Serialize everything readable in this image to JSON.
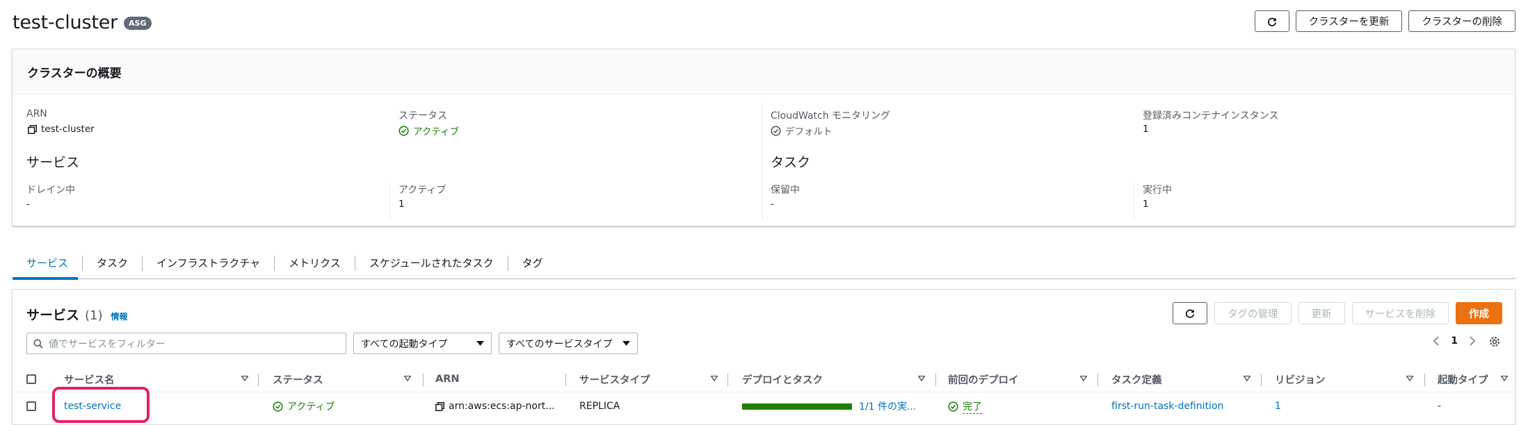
{
  "header": {
    "title": "test-cluster",
    "badge": "ASG",
    "update_button": "クラスターを更新",
    "delete_button": "クラスターの削除"
  },
  "overview": {
    "title": "クラスターの概要",
    "arn_label": "ARN",
    "arn_value": "test-cluster",
    "status_label": "ステータス",
    "status_value": "アクティブ",
    "cloudwatch_label": "CloudWatch モニタリング",
    "cloudwatch_value": "デフォルト",
    "instances_label": "登録済みコンテナインスタンス",
    "instances_value": "1",
    "services_section": "サービス",
    "draining_label": "ドレイン中",
    "draining_value": "-",
    "active_label": "アクティブ",
    "active_value": "1",
    "tasks_section": "タスク",
    "pending_label": "保留中",
    "pending_value": "-",
    "running_label": "実行中",
    "running_value": "1"
  },
  "tabs": [
    "サービス",
    "タスク",
    "インフラストラクチャ",
    "メトリクス",
    "スケジュールされたタスク",
    "タグ"
  ],
  "services": {
    "title": "サービス",
    "count": "(1)",
    "info": "情報",
    "manage_tags": "タグの管理",
    "update": "更新",
    "delete": "サービスを削除",
    "create": "作成",
    "filter_placeholder": "値でサービスをフィルター",
    "launch_type_select": "すべての起動タイプ",
    "service_type_select": "すべてのサービスタイプ",
    "page": "1",
    "columns": [
      "サービス名",
      "ステータス",
      "ARN",
      "サービスタイプ",
      "デプロイとタスク",
      "前回のデプロイ",
      "タスク定義",
      "リビジョン",
      "起動タイプ"
    ],
    "rows": [
      {
        "name": "test-service",
        "status": "アクティブ",
        "arn": "arn:aws:ecs:ap-nort...",
        "service_type": "REPLICA",
        "deploy_progress": 1.0,
        "deploy_text": "1/1 件の実...",
        "last_deploy": "完了",
        "task_definition": "first-run-task-definition",
        "revision": "1",
        "launch_type": "-"
      }
    ]
  },
  "colors": {
    "primary": "#ec7211",
    "link": "#0073bb",
    "success": "#1d8102",
    "highlight": "#e0216a"
  }
}
